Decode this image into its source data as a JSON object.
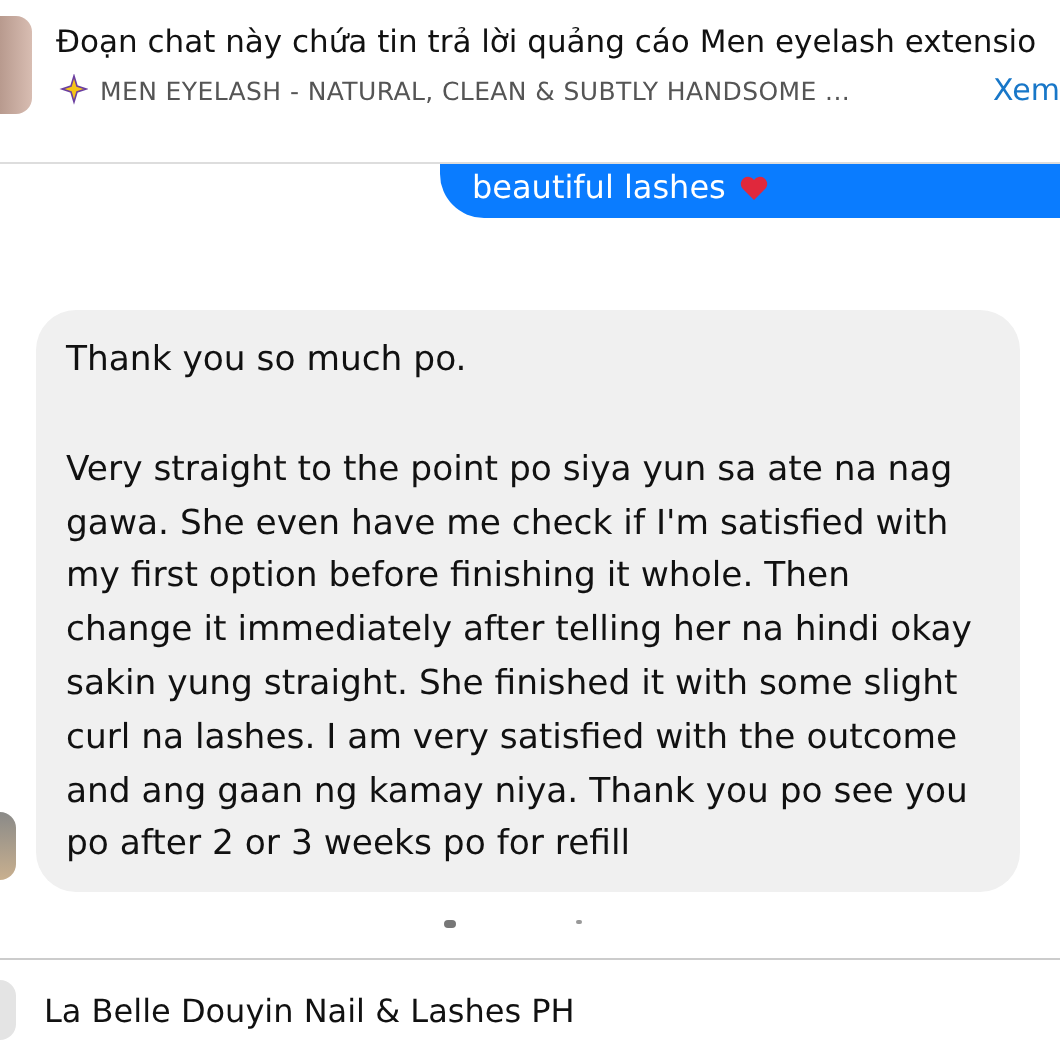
{
  "header": {
    "title": "Đoạn chat này chứa tin trả lời quảng cáo Men eyelash extensio",
    "ad_title": "MEN EYELASH - NATURAL, CLEAN & SUBTLY HANDSOME ...",
    "link": "Xem"
  },
  "messages": [
    {
      "kind": "sent",
      "paragraphs": [
        "beautiful lashes"
      ]
    },
    {
      "kind": "received",
      "paragraphs": [
        "Thank you so much po.",
        "Very straight to the point po siya yun sa ate na nag gawa. She even have me check if I'm satisfied with my first option before finishing it whole. Then change it immediately after telling her na hindi okay sakin yung straight. She finished it with some slight curl na lashes. I am very satisfied with the outcome and ang gaan ng kamay niya. Thank you po see you po after 2 or 3 weeks po for refill"
      ]
    }
  ],
  "footer": {
    "name": "La Belle Douyin Nail & Lashes PH"
  }
}
